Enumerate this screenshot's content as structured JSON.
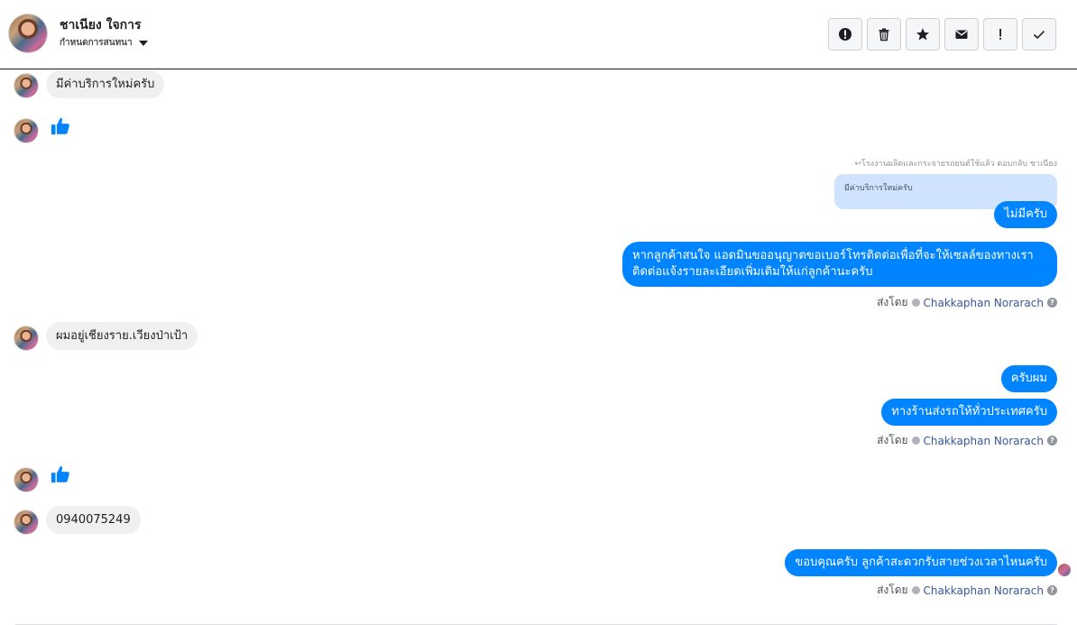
{
  "header": {
    "name": "ชาเนียง ใจการ",
    "subtitle": "กำหนดการสนทนา",
    "actions": [
      {
        "icon": "alert-circle-icon",
        "label": "report"
      },
      {
        "icon": "trash-icon",
        "label": "delete"
      },
      {
        "icon": "star-icon",
        "label": "star"
      },
      {
        "icon": "envelope-icon",
        "label": "mark-unread"
      },
      {
        "icon": "exclamation-icon",
        "label": "spam"
      },
      {
        "icon": "check-icon",
        "label": "done"
      }
    ]
  },
  "messages": {
    "m1": "มีค่าบริการใหม่ครับ",
    "reply_note": "↩โรงงานผลิตและกระจายรถยนต์ใช้แล้ว ตอบกลับ ชาเนียง",
    "reply_quote": "มีค่าบริการใหม่ครับ",
    "m2": "ไม่มีครับ",
    "m3": "หากลูกค้าสนใจ แอดมินขออนุญาตขอเบอร์โทรติดต่อเพื่อที่จะให้เซลล์ของทางเราติดต่อแจ้งรายละเอียดเพิ่มเติมให้แก่ลูกค้านะครับ",
    "m4": "ผมอยู่เชียงราย.เวียงป่าเป้า",
    "m5": "ครับผม",
    "m6": "ทางร้านส่งรถให้ทั่วประเทศครับ",
    "m7": "0940075249",
    "m8": "ขอบคุณครับ ลูกค้าสะดวกรับสายช่วงเวลาไหนครับ"
  },
  "sent_by": {
    "prefix": "ส่งโดย",
    "agent": "Chakkaphan Norarach",
    "help": "?"
  },
  "colors": {
    "outgoing": "#0084ff",
    "incoming": "#f1f0f0",
    "like": "#0084ff"
  }
}
